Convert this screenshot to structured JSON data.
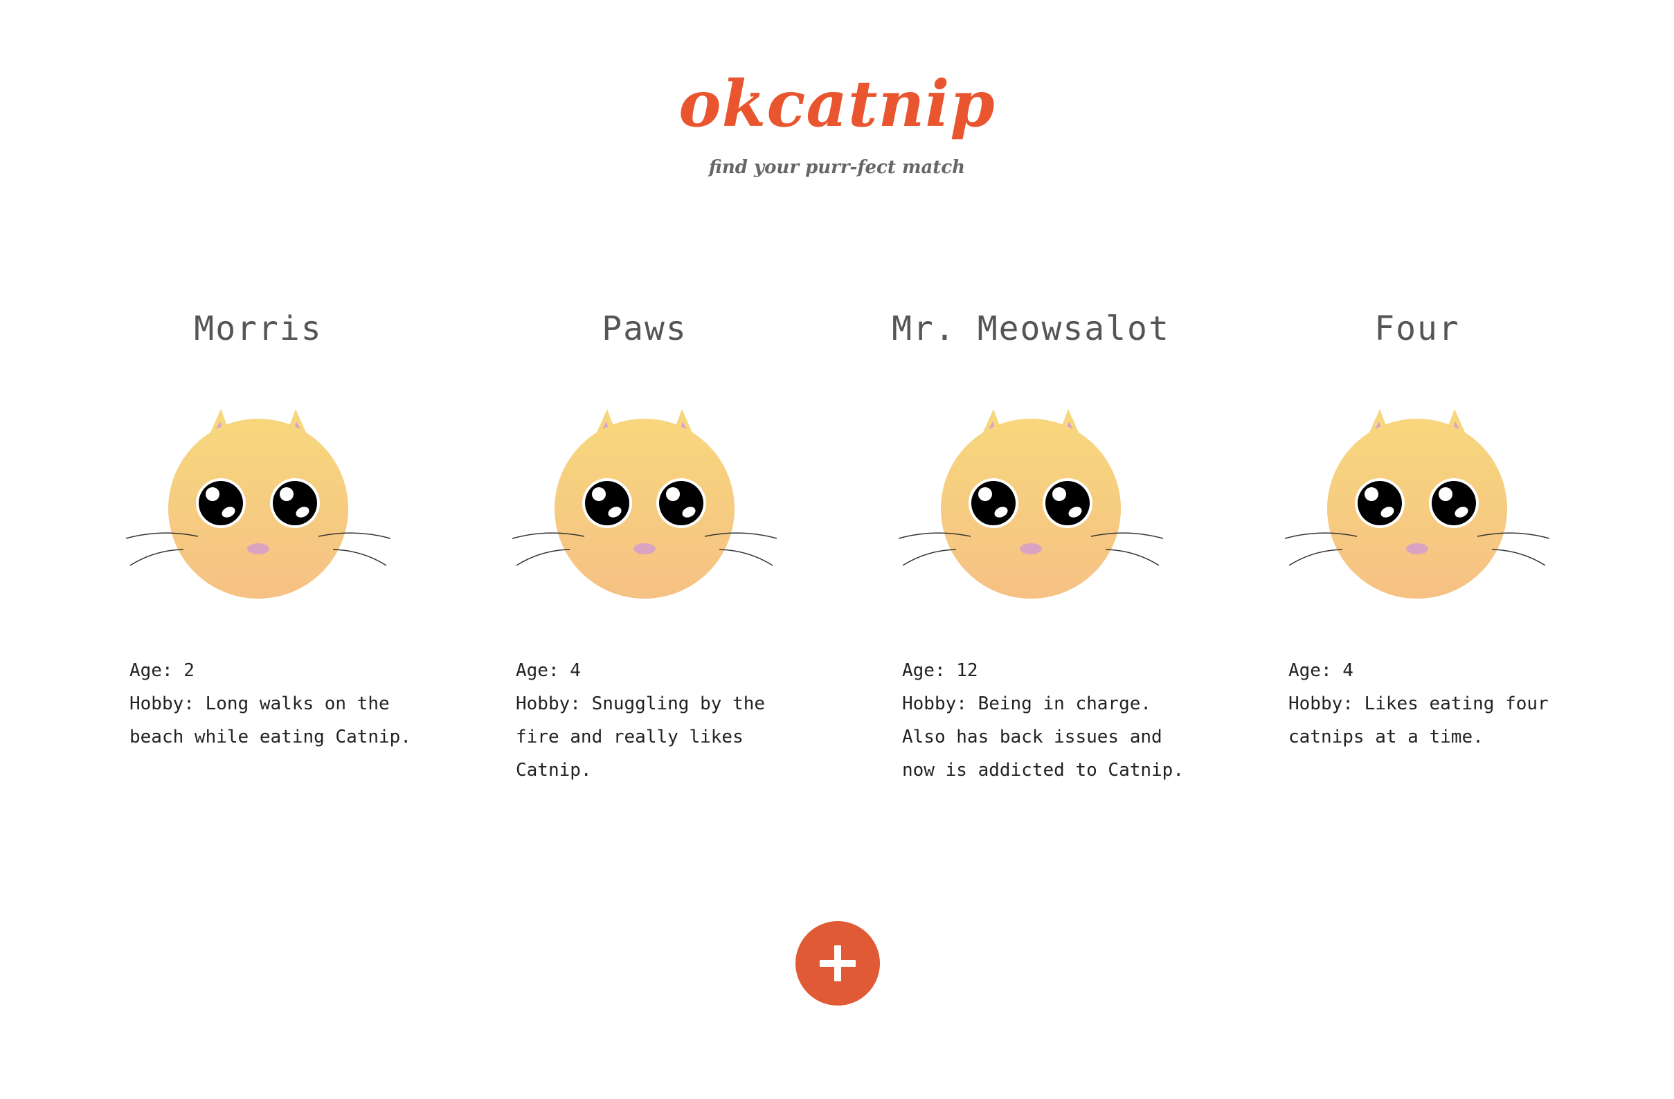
{
  "header": {
    "logo": "okcatnip",
    "tagline": "find your purr-fect match"
  },
  "colors": {
    "brand": "#e8552e",
    "add_button": "#e05a36",
    "cat_face_top": "#f7d77d",
    "cat_face_bottom": "#f6c184",
    "cat_nose": "#dba3c2"
  },
  "cats": [
    {
      "name": "Morris",
      "age_label": "Age: 2",
      "hobby_label": "Hobby: Long walks on the beach while eating Catnip."
    },
    {
      "name": "Paws",
      "age_label": "Age: 4",
      "hobby_label": "Hobby: Snuggling by the fire and really likes Catnip."
    },
    {
      "name": "Mr. Meowsalot",
      "age_label": "Age: 12",
      "hobby_label": "Hobby: Being in charge. Also has back issues and now is addicted to Catnip."
    },
    {
      "name": "Four",
      "age_label": "Age: 4",
      "hobby_label": "Hobby: Likes eating four catnips at a time."
    }
  ],
  "add_button": {
    "icon": "plus-icon"
  }
}
